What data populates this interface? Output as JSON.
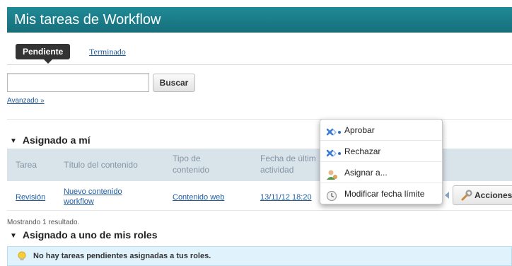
{
  "header": {
    "title": "Mis tareas de Workflow"
  },
  "tabs": [
    {
      "label": "Pendiente",
      "active": true
    },
    {
      "label": "Terminado",
      "active": false
    }
  ],
  "search": {
    "value": "",
    "button_label": "Buscar",
    "advanced_label": "Avanzado »"
  },
  "section_assigned_me": {
    "title": "Asignado a mí"
  },
  "table": {
    "headers": [
      "Tarea",
      "Título del contenido",
      "Tipo de contenido",
      "Fecha de últim actividad"
    ],
    "rows": [
      {
        "task": "Revisión",
        "content_title": "Nuevo contenido workflow",
        "content_type": "Contenido web",
        "date": "13/11/12 18:20"
      }
    ],
    "actions_label": "Acciones"
  },
  "result_count": "Mostrando 1 resultado.",
  "section_roles": {
    "title": "Asignado a uno de mis roles"
  },
  "info": {
    "message": "No hay tareas pendientes asignadas a tus roles."
  },
  "actions_menu": {
    "items": [
      {
        "label": "Aprobar",
        "icon": "approve-arrows-icon"
      },
      {
        "label": "Rechazar",
        "icon": "reject-arrows-icon"
      },
      {
        "label": "Asignar a...",
        "icon": "assign-user-icon"
      },
      {
        "label": "Modificar fecha límite",
        "icon": "clock-icon"
      }
    ]
  },
  "colors": {
    "header": "#1a7d89",
    "table_header": "#d9e3ea",
    "link": "#1f5c9e",
    "info_bg": "#e0f2fb"
  }
}
